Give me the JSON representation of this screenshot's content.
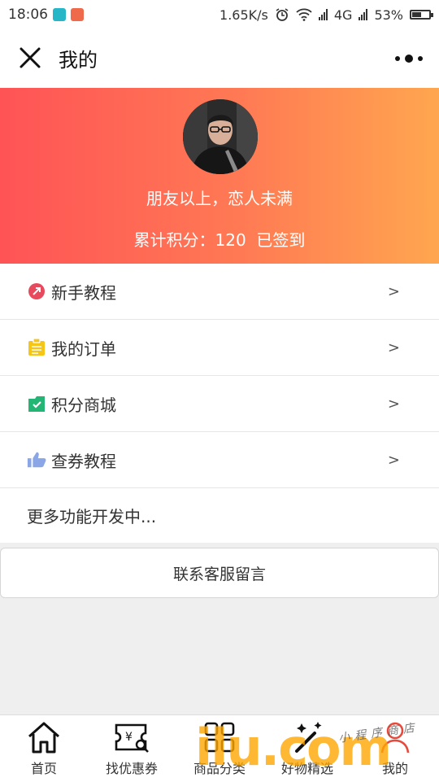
{
  "status_bar": {
    "time": "18:06",
    "speed": "1.65K/s",
    "network": "4G",
    "battery_text": "53%",
    "battery_level": 0.53
  },
  "nav": {
    "title": "我的"
  },
  "profile": {
    "nickname": "朋友以上，恋人未满",
    "points_text": "累计积分：120  已签到"
  },
  "menu": {
    "items": [
      {
        "label": "新手教程",
        "arrow": ">",
        "icon": "tutorial-icon",
        "color": "#e64a5c"
      },
      {
        "label": "我的订单",
        "arrow": ">",
        "icon": "order-icon",
        "color": "#f5c518"
      },
      {
        "label": "积分商城",
        "arrow": ">",
        "icon": "points-mall-icon",
        "color": "#22b573"
      },
      {
        "label": "查券教程",
        "arrow": ">",
        "icon": "thumbs-up-icon",
        "color": "#8aa6e6"
      }
    ],
    "more_label": "更多功能开发中..."
  },
  "contact_label": "联系客服留言",
  "tabbar": {
    "tabs": [
      {
        "label": "首页",
        "icon": "home-icon"
      },
      {
        "label": "找优惠券",
        "icon": "coupon-search-icon"
      },
      {
        "label": "商品分类",
        "icon": "category-grid-icon"
      },
      {
        "label": "好物精选",
        "icon": "magic-wand-icon"
      },
      {
        "label": "我的",
        "icon": "user-icon"
      }
    ]
  },
  "watermark": {
    "text": "ilu.com",
    "handwriting": "小程序商店"
  },
  "colors": {
    "banner_start": "#ff5356",
    "banner_end": "#ffa64f",
    "active_tab": "#e54a3c"
  }
}
